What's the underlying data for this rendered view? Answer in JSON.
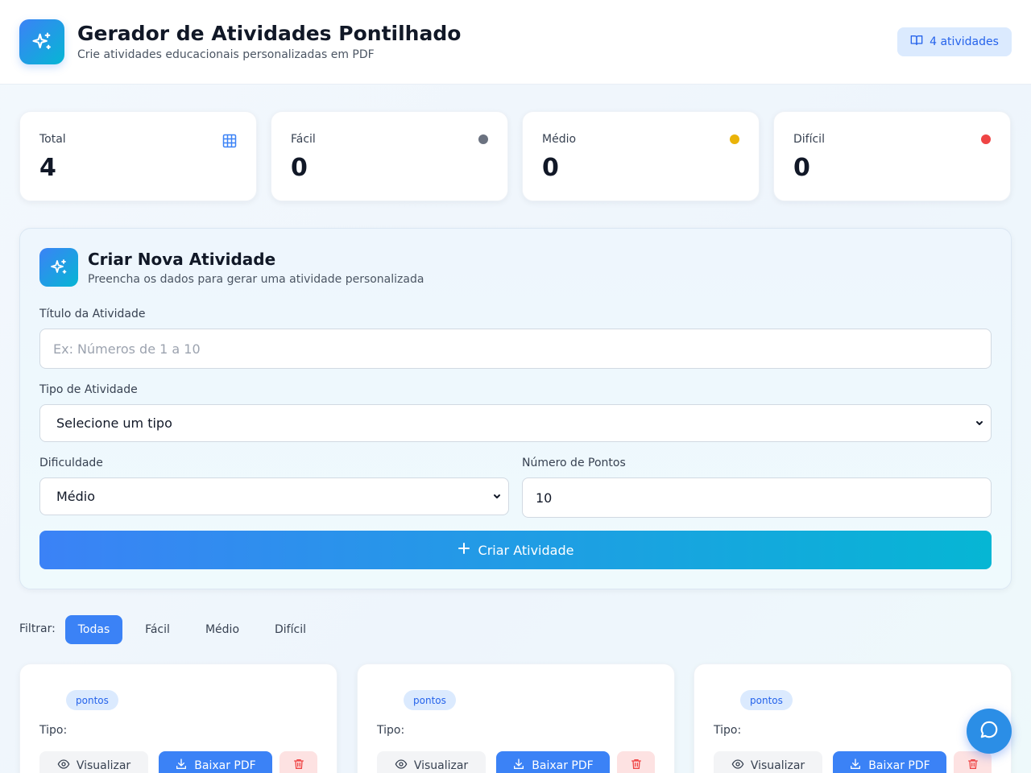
{
  "header": {
    "title": "Gerador de Atividades Pontilhado",
    "subtitle": "Crie atividades educacionais personalizadas em PDF",
    "count_badge": "4 atividades",
    "logo_icon": "sparkles-icon",
    "badge_icon": "book-open-icon"
  },
  "stats": [
    {
      "label": "Total",
      "value": "4",
      "icon": "grid-icon",
      "color": "#3b82f6"
    },
    {
      "label": "Fácil",
      "value": "0",
      "icon": "dot",
      "color": "#6b7280"
    },
    {
      "label": "Médio",
      "value": "0",
      "icon": "dot",
      "color": "#eab308"
    },
    {
      "label": "Difícil",
      "value": "0",
      "icon": "dot",
      "color": "#ef4444"
    }
  ],
  "form": {
    "title": "Criar Nova Atividade",
    "subtitle": "Preencha os dados para gerar uma atividade personalizada",
    "title_label": "Título da Atividade",
    "title_placeholder": "Ex: Números de 1 a 10",
    "title_value": "",
    "type_label": "Tipo de Atividade",
    "type_value": "Selecione um tipo",
    "difficulty_label": "Dificuldade",
    "difficulty_value": "Médio",
    "points_label": "Número de Pontos",
    "points_value": "10",
    "submit_label": "Criar Atividade"
  },
  "filters": {
    "label": "Filtrar:",
    "options": [
      "Todas",
      "Fácil",
      "Médio",
      "Difícil"
    ],
    "active": "Todas"
  },
  "activities": [
    {
      "points_badge": "pontos",
      "type_label": "Tipo:",
      "view_label": "Visualizar",
      "pdf_label": "Baixar PDF"
    },
    {
      "points_badge": "pontos",
      "type_label": "Tipo:",
      "view_label": "Visualizar",
      "pdf_label": "Baixar PDF"
    },
    {
      "points_badge": "pontos",
      "type_label": "Tipo:",
      "view_label": "Visualizar",
      "pdf_label": "Baixar PDF"
    }
  ],
  "colors": {
    "accent": "#3b82f6",
    "accent_gradient_end": "#06b6d4",
    "danger_bg": "#fde2e2",
    "danger": "#ef4444"
  }
}
